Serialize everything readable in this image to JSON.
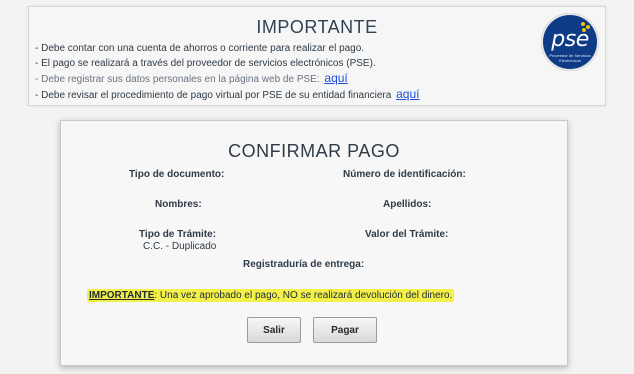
{
  "info": {
    "title": "IMPORTANTE",
    "bullets": [
      "- Debe contar con una cuenta de ahorros o corriente para realizar el pago.",
      "- El pago se realizará a través del proveedor de servicios electrónicos (PSE).",
      "- Debe registrar sus datos personales en la página web de PSE:",
      "- Debe revisar el procedimiento de pago virtual por PSE de su entidad financiera"
    ],
    "link_registrar": "aquí",
    "link_revisar": "aquí"
  },
  "pse_logo": {
    "text": "pse",
    "subtext": "Proveedor de Servicios Electrónicos",
    "colors": {
      "background": "#0e3b86",
      "accent": "#f2c200"
    }
  },
  "confirm": {
    "title": "CONFIRMAR PAGO",
    "fields": {
      "tipo_documento_label": "Tipo de documento:",
      "numero_identificacion_label": "Número de identificación:",
      "nombres_label": "Nombres:",
      "apellidos_label": "Apellidos:",
      "tipo_tramite_label": "Tipo de Trámite:",
      "tipo_tramite_value": "C.C. - Duplicado",
      "valor_tramite_label": "Valor del Trámite:",
      "registraduria_label": "Registraduría de entrega:"
    },
    "warning": {
      "strong": "IMPORTANTE",
      "text": ": Una vez aprobado el pago, NO se realizará devolución del dinero."
    },
    "buttons": {
      "salir": "Salir",
      "pagar": "Pagar"
    }
  }
}
